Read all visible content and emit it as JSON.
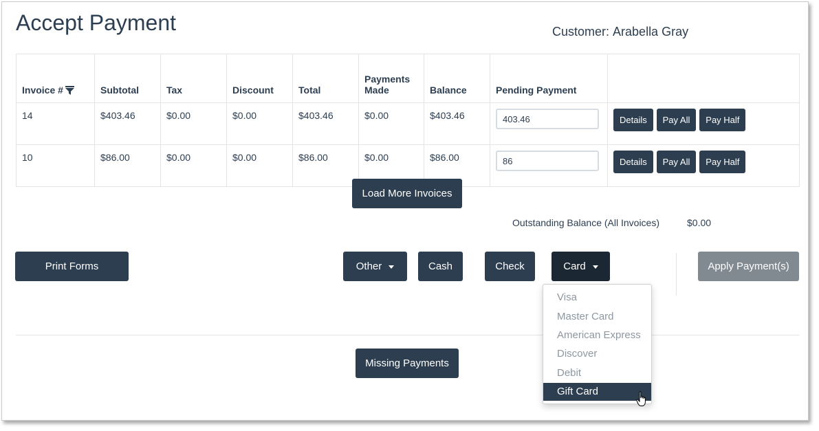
{
  "page": {
    "title": "Accept Payment"
  },
  "customer": {
    "label": "Customer:",
    "name": "Arabella Gray"
  },
  "table": {
    "headers": {
      "invoice": "Invoice #",
      "subtotal": "Subtotal",
      "tax": "Tax",
      "discount": "Discount",
      "total": "Total",
      "payments_made_1": "Payments",
      "payments_made_2": "Made",
      "balance": "Balance",
      "pending": "Pending Payment"
    },
    "rows": [
      {
        "invoice": "14",
        "subtotal": "$403.46",
        "tax": "$0.00",
        "discount": "$0.00",
        "total": "$403.46",
        "payments_made": "$0.00",
        "balance": "$403.46",
        "pending": "403.46"
      },
      {
        "invoice": "10",
        "subtotal": "$86.00",
        "tax": "$0.00",
        "discount": "$0.00",
        "total": "$86.00",
        "payments_made": "$0.00",
        "balance": "$86.00",
        "pending": "86"
      }
    ],
    "actions": {
      "details": "Details",
      "pay_all": "Pay All",
      "pay_half": "Pay Half"
    }
  },
  "buttons": {
    "load_more": "Load More Invoices",
    "print_forms": "Print Forms",
    "other": "Other",
    "cash": "Cash",
    "check": "Check",
    "card": "Card",
    "apply": "Apply Payment(s)",
    "missing": "Missing Payments"
  },
  "outstanding": {
    "label": "Outstanding Balance (All Invoices)",
    "value": "$0.00"
  },
  "card_menu": {
    "items": [
      "Visa",
      "Master Card",
      "American Express",
      "Discover",
      "Debit",
      "Gift Card"
    ],
    "selected": "Gift Card"
  },
  "colors": {
    "primary": "#2c3e50",
    "disabled": "#818991",
    "menu_text": "#8d97a0"
  },
  "icons": {
    "filter": "filter-icon",
    "caret": "caret-down-icon",
    "cursor": "hand-pointer-icon"
  }
}
